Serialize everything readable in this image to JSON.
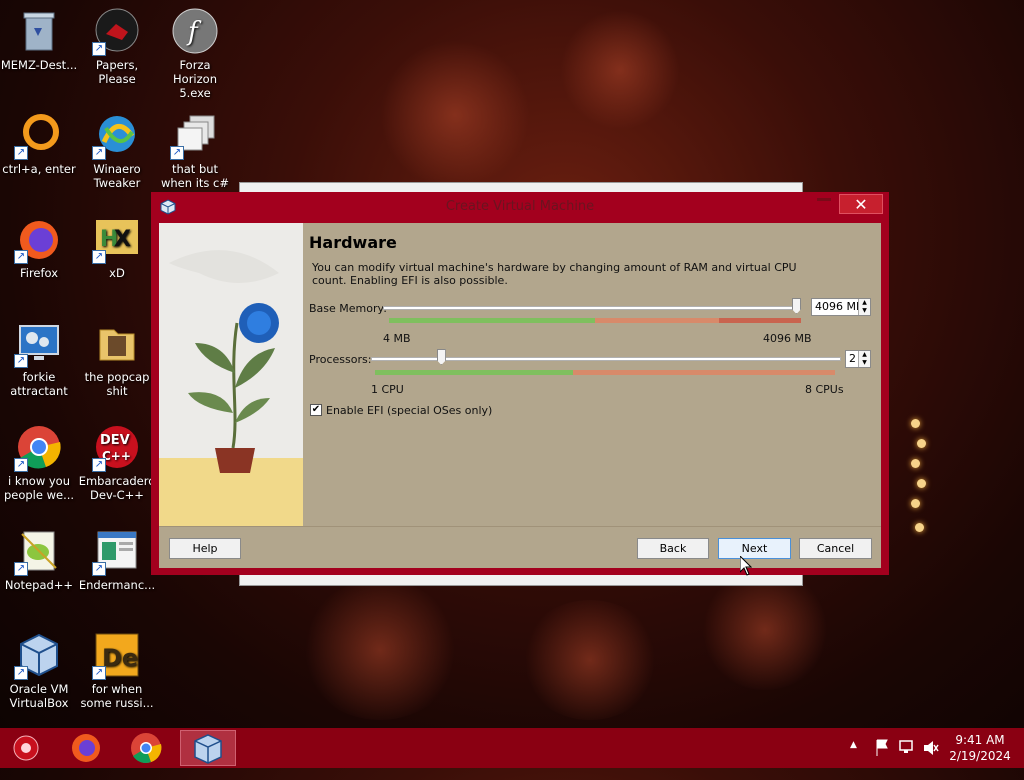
{
  "desktop": {
    "icons": [
      {
        "label": "MEMZ-Dest..."
      },
      {
        "label": "Papers, Please"
      },
      {
        "label": "Forza Horizon 5.exe"
      },
      {
        "label": "ctrl+a, enter"
      },
      {
        "label": "Winaero Tweaker"
      },
      {
        "label": "that but when its c#"
      },
      {
        "label": "Firefox"
      },
      {
        "label": "xD"
      },
      {
        "label": "forkie attractant"
      },
      {
        "label": "the popcap shit"
      },
      {
        "label": "i know you people we..."
      },
      {
        "label": "Embarcadero Dev-C++"
      },
      {
        "label": "Notepad++"
      },
      {
        "label": "Endermanc..."
      },
      {
        "label": "Oracle VM VirtualBox"
      },
      {
        "label": "for when some russi..."
      }
    ]
  },
  "dialog": {
    "title": "Create Virtual Machine",
    "close_glyph": "✕",
    "page_title": "Hardware",
    "description": "You can modify virtual machine's hardware by changing amount of RAM and virtual CPU count. Enabling EFI is also possible.",
    "memory": {
      "label": "Base Memory:",
      "value_text": "4096 MB",
      "min_label": "4 MB",
      "max_label": "4096 MB",
      "value_fraction": 1.0
    },
    "processors": {
      "label": "Processors:",
      "value_text": "2",
      "min_label": "1 CPU",
      "max_label": "8 CPUs",
      "value_fraction": 0.1429
    },
    "efi": {
      "label": "Enable EFI (special OSes only)",
      "checked": true,
      "check_glyph": "✔"
    },
    "buttons": {
      "help": "Help",
      "back": "Back",
      "next": "Next",
      "cancel": "Cancel"
    }
  },
  "taskbar": {
    "items": [
      "start-orb",
      "firefox",
      "chrome",
      "virtualbox"
    ],
    "active_item": "virtualbox",
    "clock": {
      "time": "9:41 AM",
      "date": "2/19/2024"
    },
    "tray_arrow": "▲"
  },
  "colors": {
    "accent": "#a3001e",
    "dialog_body": "#b2a68d",
    "taskbar": "#8a0012"
  }
}
